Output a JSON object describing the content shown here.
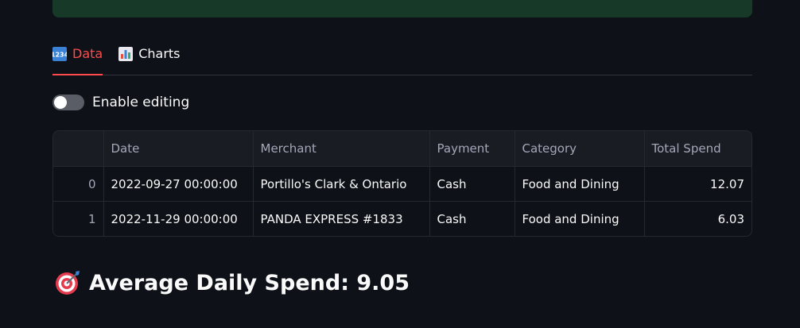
{
  "tabs": [
    {
      "label": "Data",
      "icon": "input-numbers-icon",
      "active": true
    },
    {
      "label": "Charts",
      "icon": "bar-chart-icon",
      "active": false
    }
  ],
  "toggle": {
    "label": "Enable editing",
    "on": false
  },
  "table": {
    "columns": [
      "",
      "Date",
      "Merchant",
      "Payment",
      "Category",
      "Total Spend"
    ],
    "rows": [
      {
        "index": "0",
        "date": "2022-09-27 00:00:00",
        "merchant": "Portillo's Clark & Ontario",
        "payment": "Cash",
        "category": "Food and Dining",
        "total": "12.07"
      },
      {
        "index": "1",
        "date": "2022-11-29 00:00:00",
        "merchant": "PANDA EXPRESS #1833",
        "payment": "Cash",
        "category": "Food and Dining",
        "total": "6.03"
      }
    ]
  },
  "summary": {
    "icon": "direct-hit-icon",
    "text": "Average Daily Spend: 9.05"
  },
  "colors": {
    "accent": "#ff4b4b",
    "banner": "#173928",
    "background": "#0e1117"
  }
}
